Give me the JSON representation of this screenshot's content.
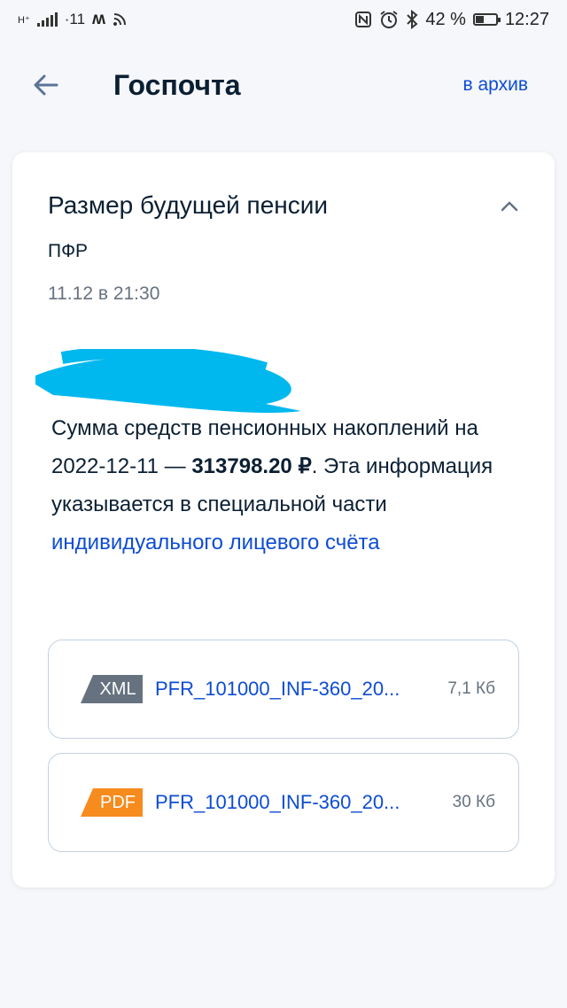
{
  "status_bar": {
    "network_label": "H⁺",
    "signal_text": "·11",
    "battery_percent": "42 %",
    "battery_level": 0.42,
    "time": "12:27",
    "icons": [
      "signal-icon",
      "m-icon",
      "wifi-icon",
      "nfc-icon",
      "alarm-icon",
      "bluetooth-icon",
      "battery-icon"
    ]
  },
  "header": {
    "title": "Госпочта",
    "archive_label": "в архив",
    "back_icon": "arrow-left-icon"
  },
  "message": {
    "title": "Размер будущей пенсии",
    "sender": "ПФР",
    "date": "11.12 в 21:30",
    "text_1": "Сумма средств пенсионных накоплений на 2022-12-11 — ",
    "amount": "313798.20 ₽",
    "text_2": ". Эта информация указывается в специальной части ",
    "link": "индивидуального лицевого счёта"
  },
  "attachments": [
    {
      "type": "XML",
      "name": "PFR_101000_INF-360_20...",
      "size": "7,1 Кб",
      "color": "#66727f"
    },
    {
      "type": "PDF",
      "name": "PFR_101000_INF-360_20...",
      "size": "30 Кб",
      "color": "#f68b1e"
    }
  ],
  "colors": {
    "link": "#0d4cd3",
    "redaction": "#00b8ee"
  }
}
